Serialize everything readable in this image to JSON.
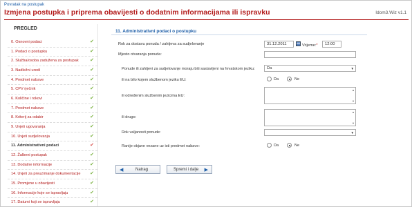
{
  "header": {
    "back_link": "Povratak na postupak",
    "title": "Izmjena postupka i priprema obavijesti o dodatnim informacijama ili ispravku",
    "version": "Idom3.Wiz v1.1"
  },
  "sidebar": {
    "title": "PREGLED",
    "items": [
      {
        "label": "0. Osnovni podaci",
        "done": true
      },
      {
        "label": "1. Podaci o postupku",
        "done": true
      },
      {
        "label": "2. Služba/osoba zadužena za postupak",
        "done": true
      },
      {
        "label": "3. Nadležni uredi",
        "done": true
      },
      {
        "label": "4. Predmet nabave",
        "done": true
      },
      {
        "label": "5. CPV rječnik",
        "done": true
      },
      {
        "label": "6. Količine i rokovi",
        "done": true
      },
      {
        "label": "7. Predmet nabave",
        "done": true
      },
      {
        "label": "8. Kriterij za odabir",
        "done": true
      },
      {
        "label": "9. Uvjeti ugovaranja",
        "done": true
      },
      {
        "label": "10. Uvjeti sudjelovanja",
        "done": true
      },
      {
        "label": "11. Administrativni podaci",
        "done": true,
        "active": true
      },
      {
        "label": "12. Žalbeni postupak",
        "done": true
      },
      {
        "label": "13. Dodatne informacije",
        "done": true
      },
      {
        "label": "14. Uvjeti za preuzimanje dokumentacije",
        "done": true
      },
      {
        "label": "15. Promjene u obavijesti",
        "done": true
      },
      {
        "label": "16. Informacije koje se ispravljaju",
        "done": true
      },
      {
        "label": "17. Datumi koji se ispravljaju",
        "done": true
      }
    ],
    "check_glyph": "✔"
  },
  "form": {
    "section_title": "11. Administrativni podaci o postupku",
    "deadline": {
      "label": "Rok za dostavu ponuda / zahtjeva za sudjelovanje",
      "date": "31.12.2011",
      "time_label": "Vrijeme:",
      "time_required": "*",
      "time": "12:00"
    },
    "opening_place": {
      "label": "Mjesto otvaranja ponuda:",
      "value": ""
    },
    "language_croatian": {
      "label": "Ponude ili zahtjevi za sudjelovanje moraju biti sastavljeni na hrvatskom jeziku:",
      "value": "Da"
    },
    "any_eu_language": {
      "label": "ili na bilo kojem službenom jeziku EU:",
      "options": [
        "Da",
        "Ne"
      ],
      "selected": "Ne"
    },
    "specific_eu_language": {
      "label": "ili određenim službenim jezicima EU:",
      "value": ""
    },
    "other_language": {
      "label": "ili drugo:",
      "value": ""
    },
    "validity": {
      "label": "Rok valjanosti ponude:",
      "value": ""
    },
    "prior_notices": {
      "label": "Ranije objave vezane uz isti predmet nabave:",
      "options": [
        "Da",
        "Ne"
      ],
      "selected": "Ne"
    }
  },
  "buttons": {
    "back": "Natrag",
    "next": "Spremi i dalje",
    "back_icon": "◀",
    "next_icon": "▶"
  },
  "icons": {
    "select_arrow": "▼",
    "scroll_up": "▲",
    "scroll_down": "▼"
  },
  "colors": {
    "title": "#b31b1b",
    "link": "#1f5fa8",
    "check": "#7cb342"
  }
}
